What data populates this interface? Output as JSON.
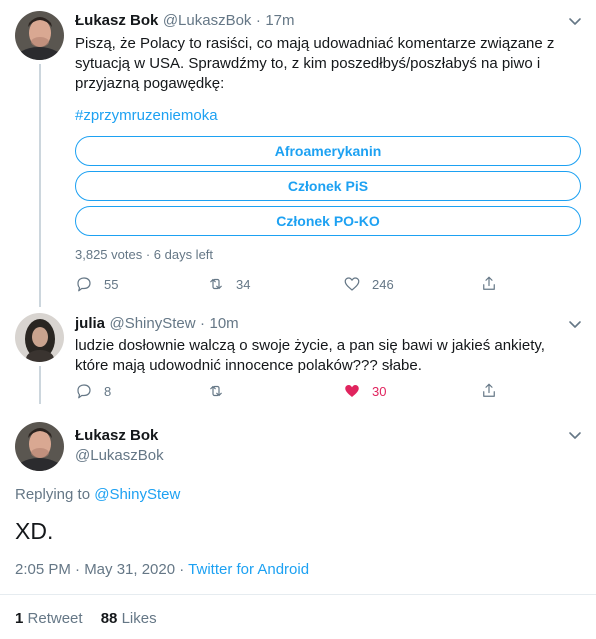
{
  "tweet1": {
    "name": "Łukasz Bok",
    "handle": "@LukaszBok",
    "separator": "·",
    "time": "17m",
    "text": "Piszą, że Polacy to rasiści, co mają udowadniać komentarze związane z sytuacją w USA. Sprawdźmy to, z kim poszedłbyś/poszłabyś na piwo i przyjazną pogawędkę:",
    "hashtag": "#zprzymruzeniemoka",
    "poll_options": [
      "Afroamerykanin",
      "Członek PiS",
      "Członek PO-KO"
    ],
    "poll_meta": "3,825 votes · 6 days left",
    "replies": "55",
    "retweets": "34",
    "likes": "246"
  },
  "tweet2": {
    "name": "julia",
    "handle": "@ShinyStew",
    "separator": "·",
    "time": "10m",
    "text": "ludzie dosłownie walczą o swoje życie, a pan się bawi w jakieś ankiety, które mają udowodnić innocence polaków??? słabe.",
    "replies": "8",
    "retweets": "",
    "likes": "30"
  },
  "main": {
    "name": "Łukasz Bok",
    "handle": "@LukaszBok",
    "replying_prefix": "Replying to",
    "replying_to": "@ShinyStew",
    "text": "XD.",
    "time": "2:05 PM · May 31, 2020 ·",
    "source": "Twitter for Android",
    "retweet_count": "1",
    "retweet_label": "Retweet",
    "likes_count": "88",
    "likes_label": "Likes"
  },
  "colors": {
    "accent": "#1da1f2",
    "like_active": "#e0245e",
    "muted": "#657786"
  }
}
